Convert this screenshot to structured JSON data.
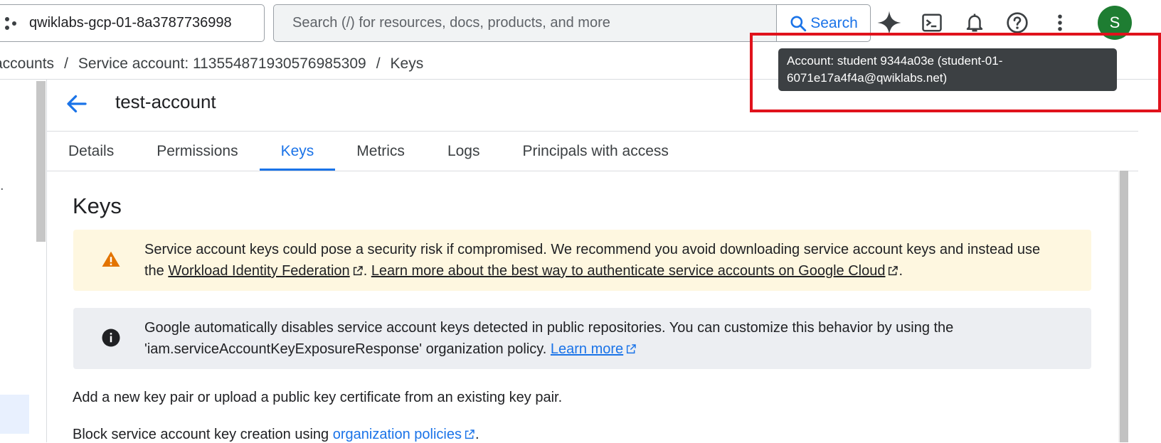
{
  "topbar": {
    "project_name": "qwiklabs-gcp-01-8a3787736998",
    "search_placeholder": "Search (/) for resources, docs, products, and more",
    "search_button": "Search",
    "avatar_initial": "S",
    "icons": [
      "hexagon-project-icon",
      "search-icon",
      "gemini-sparkle-icon",
      "cloud-shell-icon",
      "notifications-bell-icon",
      "help-icon",
      "more-vert-icon"
    ]
  },
  "breadcrumb": {
    "items": [
      "accounts",
      "Service account: 113554871930576985309",
      "Keys"
    ],
    "separator": "/"
  },
  "left_nav": {
    "dot": "."
  },
  "header": {
    "title": "test-account"
  },
  "tabs": [
    {
      "label": "Details",
      "active": false
    },
    {
      "label": "Permissions",
      "active": false
    },
    {
      "label": "Keys",
      "active": true
    },
    {
      "label": "Metrics",
      "active": false
    },
    {
      "label": "Logs",
      "active": false
    },
    {
      "label": "Principals with access",
      "active": false
    }
  ],
  "content": {
    "section_title": "Keys",
    "warning": {
      "text_1": "Service account keys could pose a security risk if compromised. We recommend you avoid downloading service account keys and instead use the ",
      "link_1": "Workload Identity Federation",
      "text_2": ". ",
      "link_2": "Learn more about the best way to authenticate service accounts on Google Cloud",
      "text_3": "."
    },
    "info": {
      "text_1": "Google automatically disables service account keys detected in public repositories. You can customize this behavior by using the 'iam.serviceAccountKeyExposureResponse' organization policy. ",
      "link": "Learn more"
    },
    "add_key_text": "Add a new key pair or upload a public key certificate from an existing key pair.",
    "block_text": "Block service account key creation using ",
    "block_link": "organization policies",
    "block_end": "."
  },
  "tooltip": {
    "line_1": "Account: student 9344a03e (student-01-",
    "line_2": "6071e17a4f4a@qwiklabs.net)"
  },
  "colors": {
    "accent": "#1a73e8",
    "avatar": "#1e7d32",
    "warning_bg": "#fef7e0",
    "warning_icon": "#e37400",
    "info_bg": "#eceef2",
    "highlight": "#e0121c",
    "tooltip_bg": "#3c4043"
  }
}
